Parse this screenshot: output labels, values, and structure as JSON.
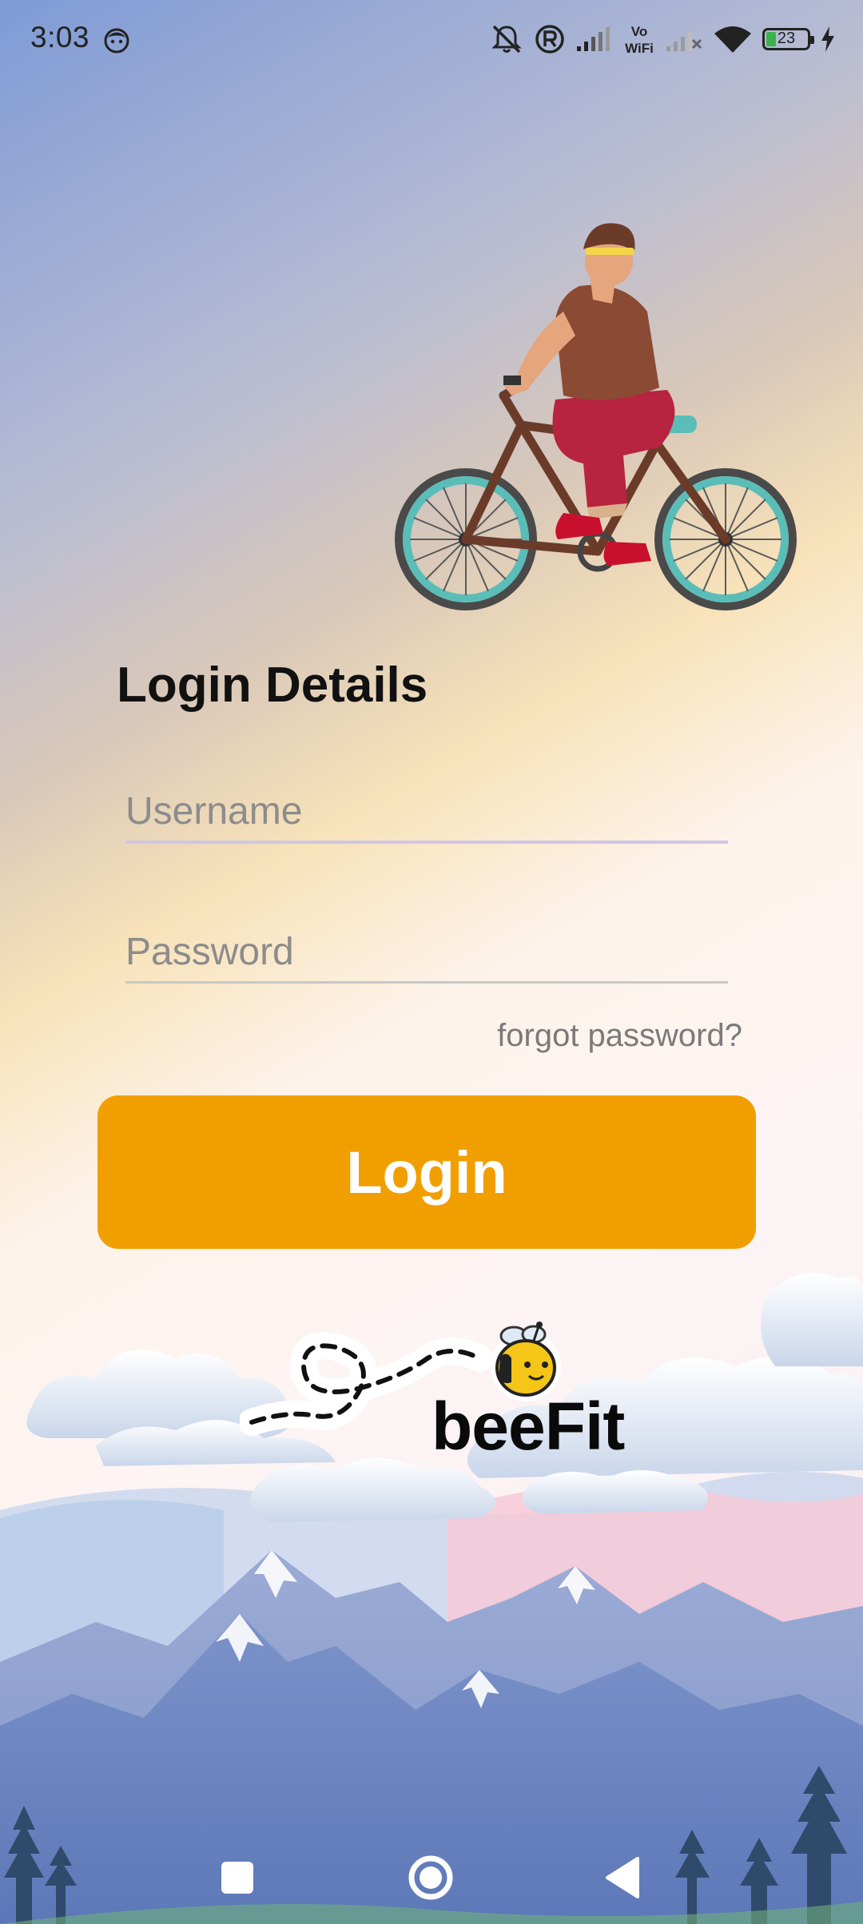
{
  "status_bar": {
    "time": "3:03",
    "battery_level": "23",
    "icons": [
      "face-icon",
      "mute-icon",
      "registered-icon",
      "signal-icon",
      "vowifi-icon",
      "signal-no-sim-icon",
      "wifi-icon",
      "battery-icon",
      "charging-icon"
    ],
    "vowifi_top": "Vo",
    "vowifi_bottom": "WiFi"
  },
  "form": {
    "title": "Login Details",
    "username_placeholder": "Username",
    "password_placeholder": "Password",
    "forgot_label": "forgot password?",
    "login_label": "Login"
  },
  "brand": {
    "name": "beeFit"
  },
  "colors": {
    "accent": "#f19f00",
    "battery_fill": "#3bb34a"
  },
  "nav_bar": {
    "buttons": [
      "recents-icon",
      "home-icon",
      "back-icon"
    ]
  }
}
